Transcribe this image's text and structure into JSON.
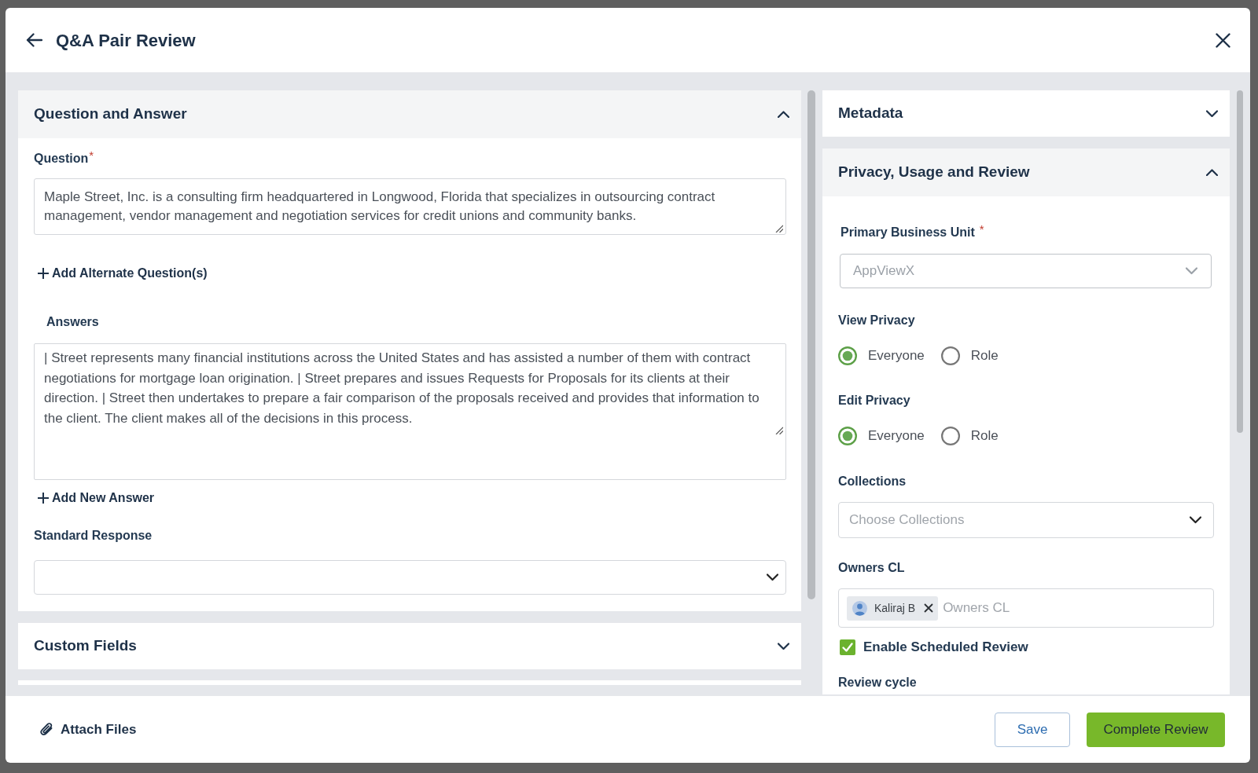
{
  "dialog": {
    "title": "Q&A Pair Review"
  },
  "question_answer": {
    "title": "Question and Answer",
    "expanded": true,
    "question": {
      "label": "Question",
      "required_mark": "*",
      "value": "Maple Street, Inc. is a consulting firm headquartered in Longwood, Florida that specializes in outsourcing contract management, vendor management and negotiation services for credit unions and community banks."
    },
    "add_alternate_question": "Add Alternate Question(s)",
    "answers": {
      "label": "Answers",
      "value": "| Street represents many financial institutions across the United States and has assisted a number of them with contract negotiations for mortgage loan origination. | Street prepares and issues Requests for Proposals for its clients at their direction. | Street then undertakes to prepare a fair comparison of the proposals received and provides that information to the client. The client makes all of the decisions in this process."
    },
    "add_new_answer": "Add New Answer",
    "standard_response": {
      "label": "Standard Response"
    }
  },
  "custom_fields": {
    "title": "Custom Fields",
    "expanded": false
  },
  "metadata": {
    "title": "Metadata",
    "expanded": false
  },
  "privacy_usage_review": {
    "title": "Privacy, Usage and Review",
    "expanded": true,
    "primary_business_unit": {
      "label": "Primary Business Unit",
      "required_mark": "*",
      "value": "AppViewX",
      "disabled": true
    },
    "view_privacy": {
      "label": "View Privacy",
      "options": [
        {
          "label": "Everyone",
          "selected": true
        },
        {
          "label": "Role",
          "selected": false
        }
      ]
    },
    "edit_privacy": {
      "label": "Edit Privacy",
      "options": [
        {
          "label": "Everyone",
          "selected": true
        },
        {
          "label": "Role",
          "selected": false
        }
      ]
    },
    "collections": {
      "label": "Collections",
      "placeholder": "Choose Collections"
    },
    "owners": {
      "label": "Owners CL",
      "chips": [
        {
          "label": "Kaliraj B"
        }
      ],
      "placeholder": "Owners CL"
    },
    "scheduled_review": {
      "label": "Enable Scheduled Review",
      "checked": true
    },
    "review_cycle": {
      "label": "Review cycle"
    }
  },
  "footer": {
    "attach_files": "Attach Files",
    "buttons": [
      {
        "label": "Save",
        "kind": "secondary"
      },
      {
        "label": "Complete Review",
        "kind": "primary"
      }
    ]
  }
}
